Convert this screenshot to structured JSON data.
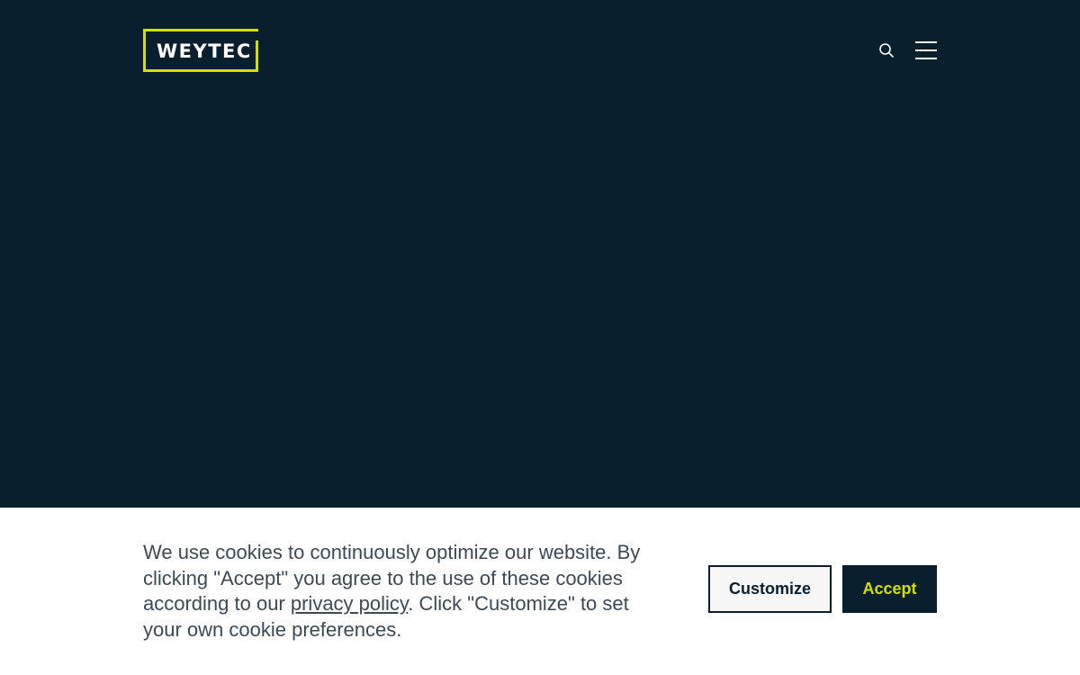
{
  "header": {
    "logo_text": "WEYTEC",
    "icons": {
      "search": "search-icon",
      "menu": "hamburger-menu-icon"
    }
  },
  "cookie_banner": {
    "text_before_link": "We use cookies to continuously optimize our website. By clicking \"Accept\" you agree to the use of these cookies according to our ",
    "link_text": "privacy policy",
    "text_after_link": ". Click \"Customize\" to set your own cookie preferences.",
    "customize_label": "Customize",
    "accept_label": "Accept"
  },
  "colors": {
    "background": "#0a1f2d",
    "accent": "#d2e000",
    "banner_background": "#ffffff",
    "banner_text": "#3c4a56"
  }
}
